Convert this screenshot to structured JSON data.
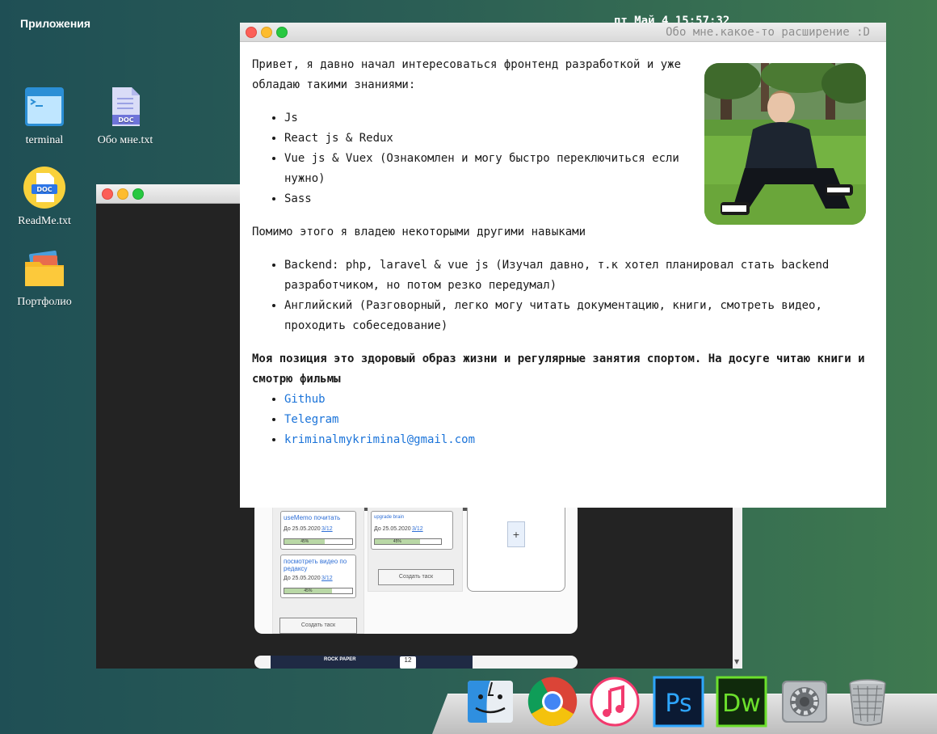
{
  "topbar": {
    "apps_label": "Приложения",
    "clock": "пт Май 4  15:57:32"
  },
  "desktop_icons": [
    {
      "label": "terminal",
      "icon": "terminal-icon"
    },
    {
      "label": "Обо мне.txt",
      "icon": "doc-file-icon",
      "badge": "DOC"
    },
    {
      "label": "ReadMe.txt",
      "icon": "doc-circle-icon",
      "badge": "DOC"
    },
    {
      "label": "Портфолио",
      "icon": "folder-icon"
    }
  ],
  "about_window": {
    "title": "Обо мне.какое-то расширение :D",
    "intro": "Привет, я давно начал интересоваться фронтенд разработкой и уже обладаю такими знаниями:",
    "skills": [
      "Js",
      "React js & Redux",
      "Vue js & Vuex (Ознакомлен и могу быстро переключиться если нужно)",
      "Sass"
    ],
    "other_intro": "Помимо этого я владею некоторыми другими навыками",
    "other_skills": [
      "Backend: php, laravel & vue js (Изучал давно, т.к хотел планировал стать backend разработчиком, но потом резко передумал)",
      "Английский (Разговорный, легко могу читать документацию, книги, смотреть видео, проходить собеседование)"
    ],
    "position": "Моя позиция это здоровый образ жизни и регулярные занятия спортом. На досуге читаю книги и смотрю фильмы",
    "links": [
      "Github",
      "Telegram",
      "kriminalmykriminal@gmail.com"
    ]
  },
  "portfolio_preview": {
    "tasks": [
      {
        "title": "useMemo почитать",
        "date": "До 25.05.2020",
        "count": "3/12",
        "progress": "45%"
      },
      {
        "title": "посмотреть видео по редаксу",
        "date": "До 25.05.2020",
        "count": "3/12",
        "progress": "45%"
      },
      {
        "title": "upgrade brain",
        "date": "До 25.05.2020",
        "count": "3/12",
        "progress": "45%"
      }
    ],
    "create_task_label": "Создать таск",
    "add_label": "+",
    "card2_text": "ROCK PAPER",
    "card2_date": "12"
  },
  "dock": [
    {
      "name": "finder-icon"
    },
    {
      "name": "chrome-icon"
    },
    {
      "name": "itunes-icon"
    },
    {
      "name": "photoshop-icon",
      "label": "Ps"
    },
    {
      "name": "dreamweaver-icon",
      "label": "Dw"
    },
    {
      "name": "system-preferences-icon"
    },
    {
      "name": "trash-icon"
    }
  ]
}
